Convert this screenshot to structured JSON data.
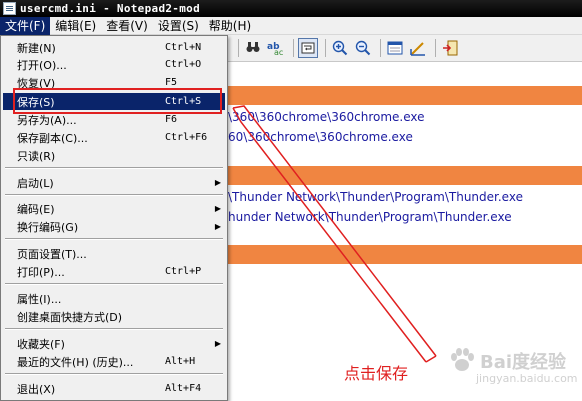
{
  "window": {
    "title": "usercmd.ini - Notepad2-mod"
  },
  "menubar": [
    {
      "label": "文件(F)",
      "active": true
    },
    {
      "label": "编辑(E)",
      "active": false
    },
    {
      "label": "查看(V)",
      "active": false
    },
    {
      "label": "设置(S)",
      "active": false
    },
    {
      "label": "帮助(H)",
      "active": false
    }
  ],
  "file_menu": {
    "new": {
      "label": "新建(N)",
      "shortcut": "Ctrl+N"
    },
    "open": {
      "label": "打开(O)...",
      "shortcut": "Ctrl+O"
    },
    "revert": {
      "label": "恢复(V)",
      "shortcut": "F5"
    },
    "save": {
      "label": "保存(S)",
      "shortcut": "Ctrl+S"
    },
    "save_as": {
      "label": "另存为(A)...",
      "shortcut": "F6"
    },
    "save_copy": {
      "label": "保存副本(C)...",
      "shortcut": "Ctrl+F6"
    },
    "readonly": {
      "label": "只读(R)"
    },
    "launch": {
      "label": "启动(L)"
    },
    "encoding": {
      "label": "编码(E)"
    },
    "line_endings": {
      "label": "换行编码(G)"
    },
    "page_setup": {
      "label": "页面设置(T)..."
    },
    "print": {
      "label": "打印(P)...",
      "shortcut": "Ctrl+P"
    },
    "properties": {
      "label": "属性(I)..."
    },
    "create_shortcut": {
      "label": "创建桌面快捷方式(D)"
    },
    "favorites": {
      "label": "收藏夹(F)"
    },
    "recent": {
      "label": "最近的文件(H) (历史)...",
      "shortcut": "Alt+H"
    },
    "exit": {
      "label": "退出(X)",
      "shortcut": "Alt+F4"
    }
  },
  "editor": {
    "lines": [
      "\\360\\360chrome\\360chrome.exe",
      "60\\360chrome\\360chrome.exe",
      "\\Thunder Network\\Thunder\\Program\\Thunder.exe",
      "hunder Network\\Thunder\\Program\\Thunder.exe"
    ],
    "highlight_color": "#f08541",
    "text_color": "#1a1aa0"
  },
  "annotation": {
    "text": "点击保存",
    "color": "#e02020"
  },
  "watermark": {
    "name": "Bai度经验",
    "domain": "jingyan.baidu.com"
  },
  "icons": {
    "toolbar": [
      "find-icon",
      "replace-icon",
      "word-wrap-icon",
      "zoom-in-icon",
      "zoom-out-icon",
      "scheme-icon",
      "customize-icon",
      "exit-icon"
    ]
  }
}
